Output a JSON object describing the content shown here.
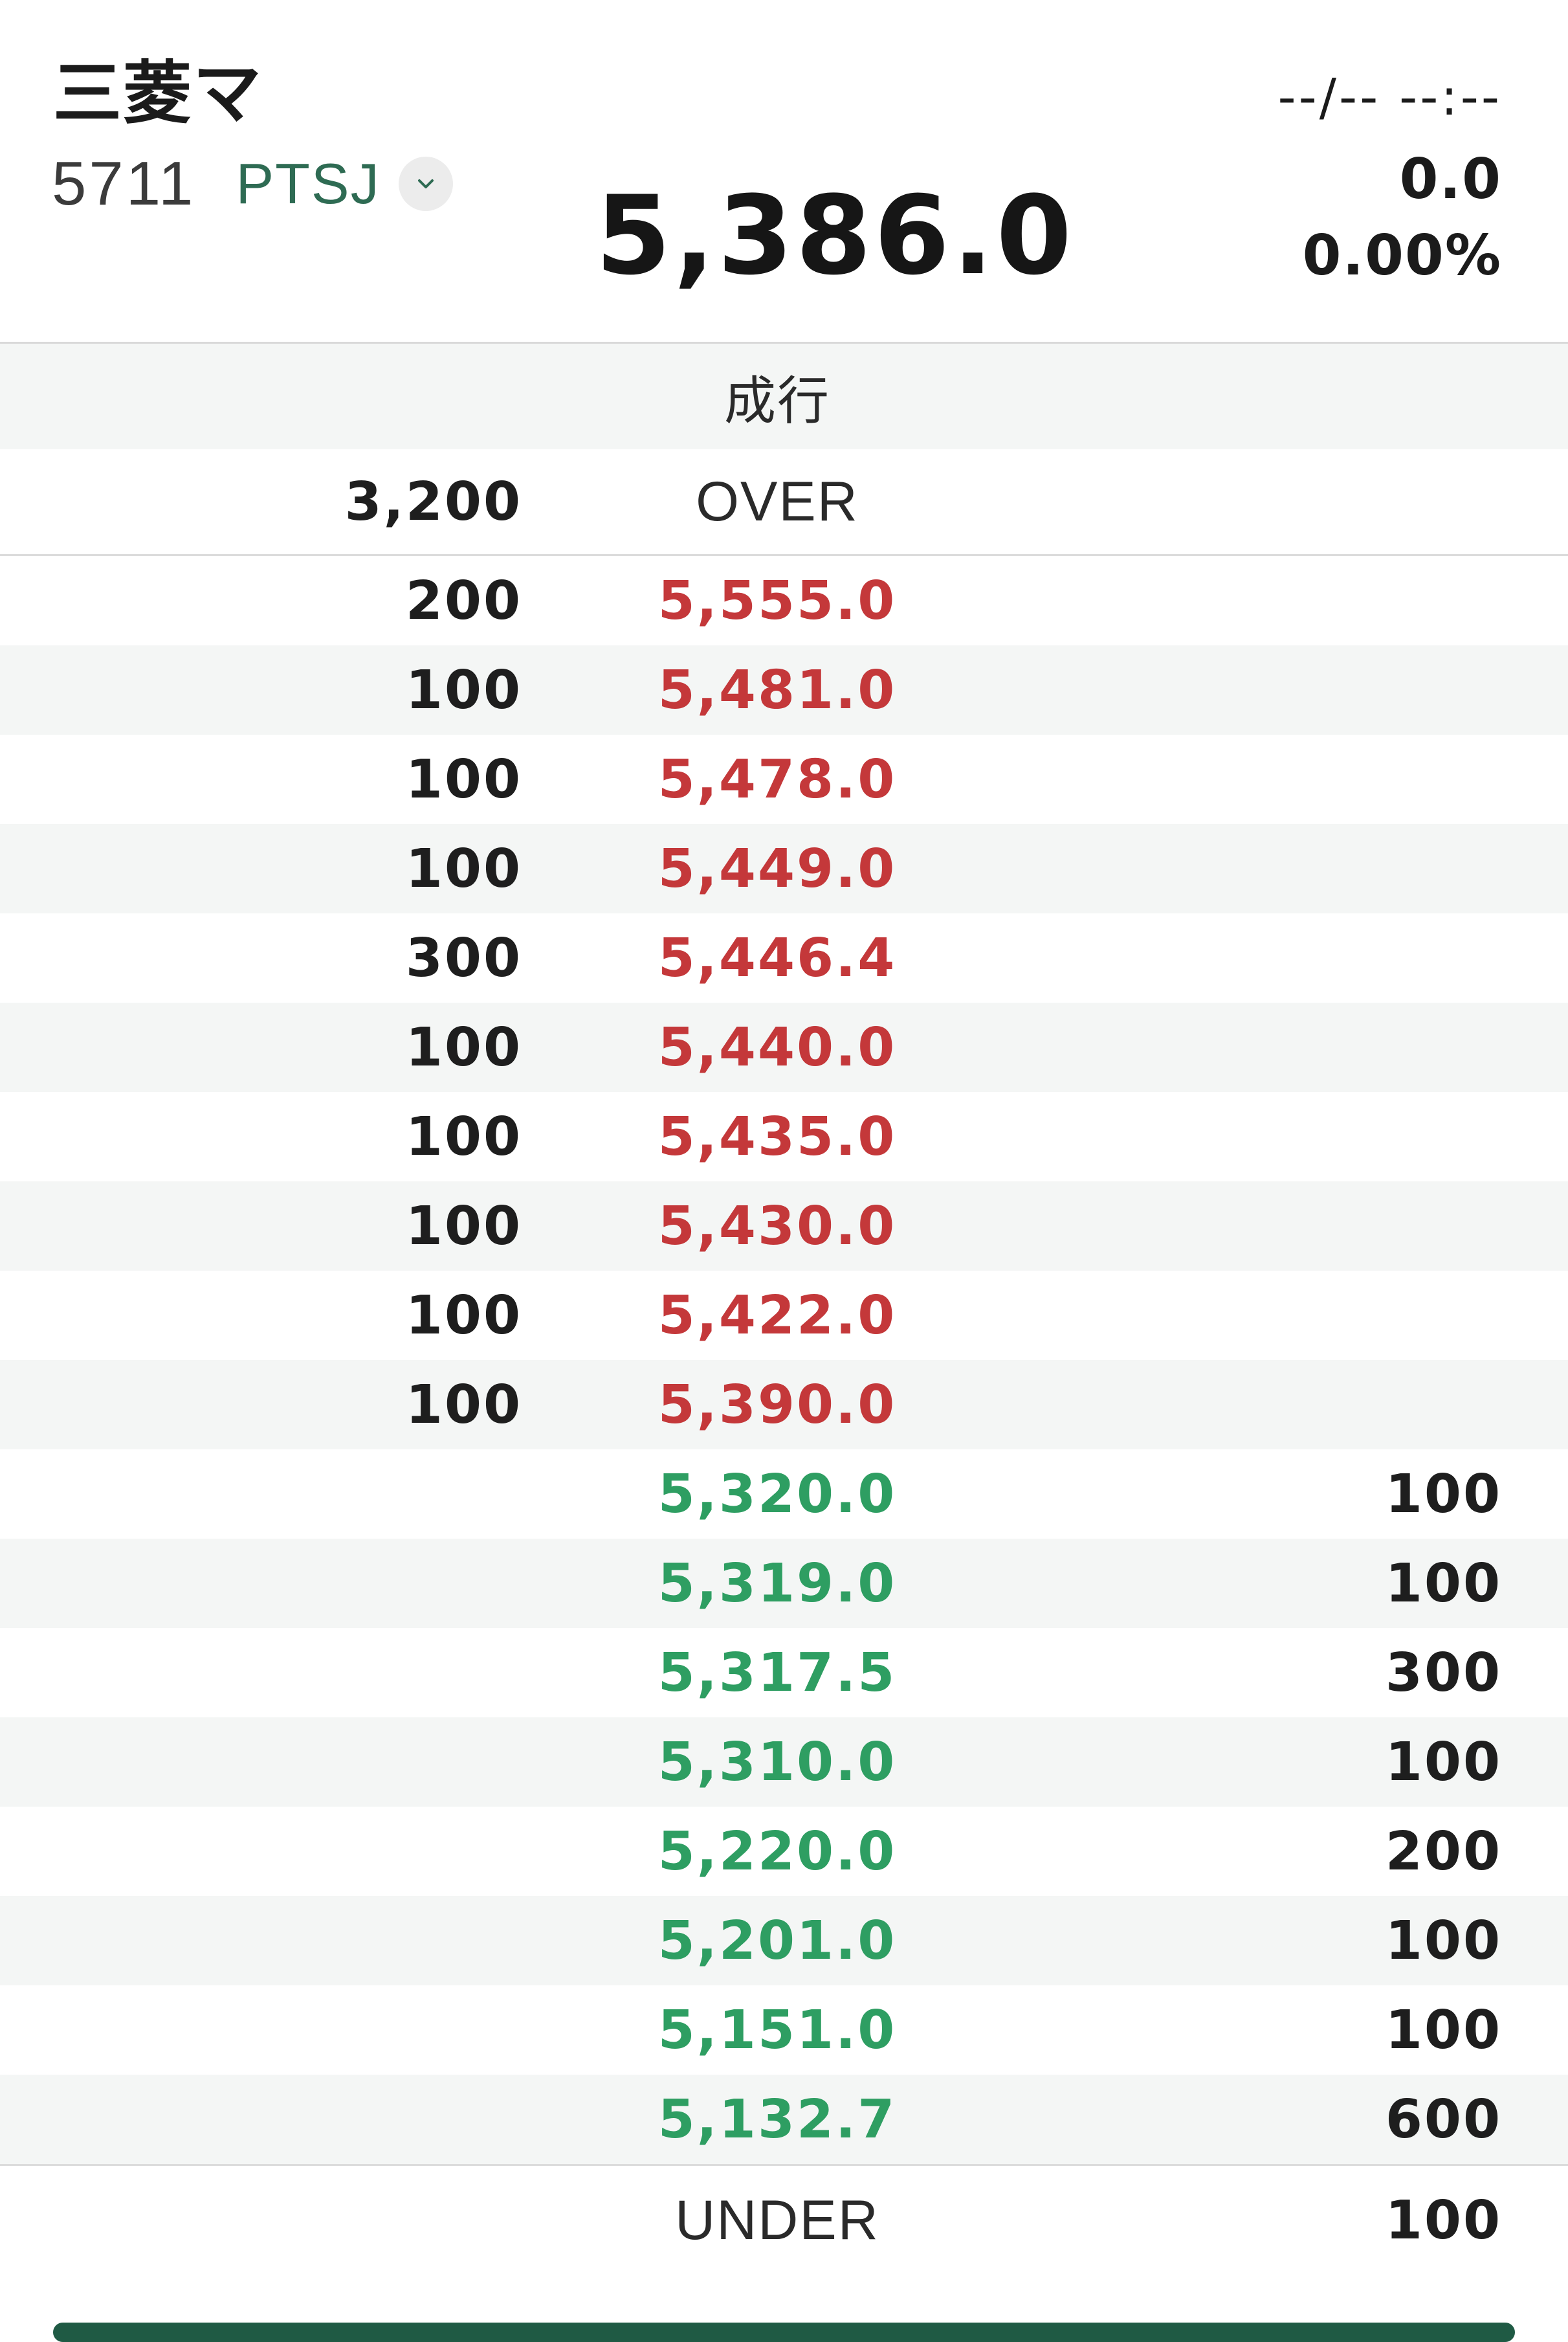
{
  "header": {
    "stock_name": "三菱マ",
    "stock_code": "5711",
    "market": "PTSJ",
    "price": "5,386.0",
    "timestamp": "--/-- --:--",
    "change": "0.0",
    "change_pct": "0.00%"
  },
  "board": {
    "market_order_label": "成行",
    "over_label": "OVER",
    "over_qty": "3,200",
    "under_label": "UNDER",
    "under_qty": "100",
    "asks": [
      {
        "qty": "200",
        "price": "5,555.0"
      },
      {
        "qty": "100",
        "price": "5,481.0"
      },
      {
        "qty": "100",
        "price": "5,478.0"
      },
      {
        "qty": "100",
        "price": "5,449.0"
      },
      {
        "qty": "300",
        "price": "5,446.4"
      },
      {
        "qty": "100",
        "price": "5,440.0"
      },
      {
        "qty": "100",
        "price": "5,435.0"
      },
      {
        "qty": "100",
        "price": "5,430.0"
      },
      {
        "qty": "100",
        "price": "5,422.0"
      },
      {
        "qty": "100",
        "price": "5,390.0"
      }
    ],
    "bids": [
      {
        "price": "5,320.0",
        "qty": "100"
      },
      {
        "price": "5,319.0",
        "qty": "100"
      },
      {
        "price": "5,317.5",
        "qty": "300"
      },
      {
        "price": "5,310.0",
        "qty": "100"
      },
      {
        "price": "5,220.0",
        "qty": "200"
      },
      {
        "price": "5,201.0",
        "qty": "100"
      },
      {
        "price": "5,151.0",
        "qty": "100"
      },
      {
        "price": "5,132.7",
        "qty": "600"
      }
    ]
  },
  "icons": {
    "market_toggle": "chevron-down-icon"
  },
  "colors": {
    "ask_price": "#c4383a",
    "bid_price": "#2e9e62",
    "market_text": "#2e6b53",
    "row_shade": "#f4f6f5"
  }
}
